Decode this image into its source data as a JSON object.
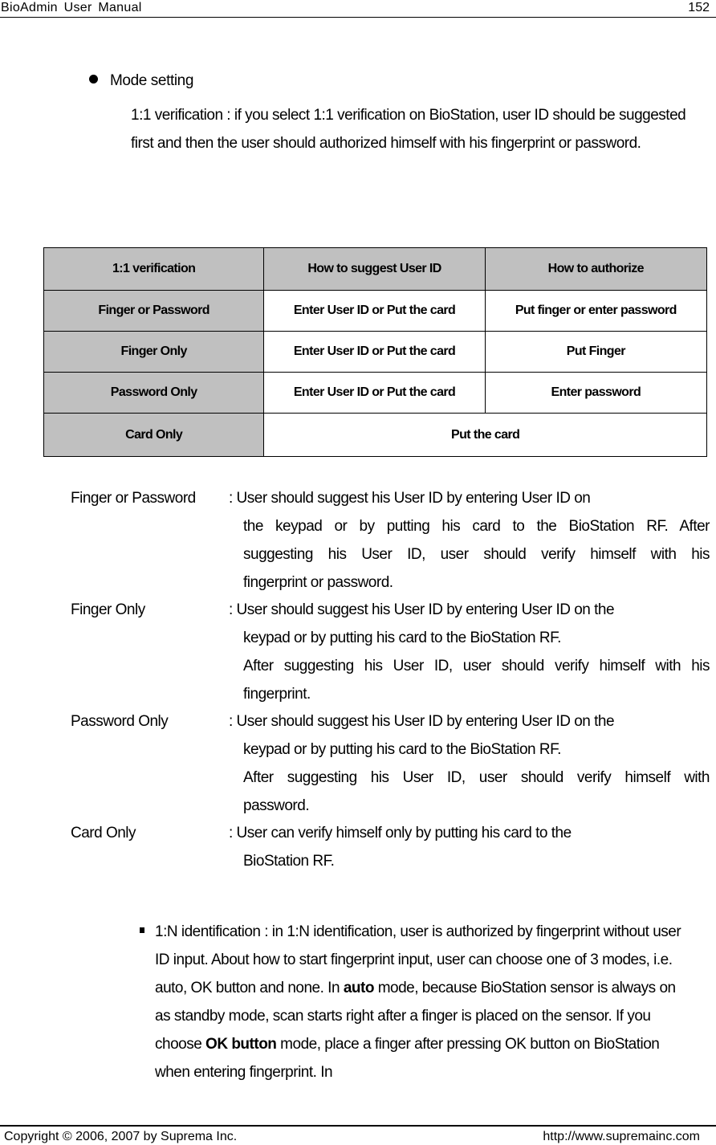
{
  "header": {
    "title": "BioAdmin  User  Manual",
    "page_number": "152"
  },
  "section": {
    "bullet_title": "Mode setting",
    "intro": "1:1 verification : if you select 1:1 verification on BioStation, user ID should be suggested first and then the user should authorized himself with his fingerprint or password."
  },
  "table": {
    "headers": [
      "1:1 verification",
      "How to suggest User ID",
      "How to authorize"
    ],
    "rows": [
      {
        "mode": "Finger or Password",
        "suggest": "Enter User ID or Put the card",
        "authorize": "Put finger or enter password"
      },
      {
        "mode": "Finger Only",
        "suggest": "Enter User ID or Put the card",
        "authorize": "Put Finger"
      },
      {
        "mode": "Password Only",
        "suggest": "Enter User ID or Put the card",
        "authorize": "Enter password"
      },
      {
        "mode": "Card Only",
        "merged": "Put the card"
      }
    ]
  },
  "definitions": [
    {
      "term": "Finger or Password",
      "first_line": ": User should suggest his User ID by entering User ID on",
      "lines": [
        "the keypad or by putting his card to the BioStation RF. After",
        "suggesting his User ID, user should verify himself with his",
        "fingerprint or password."
      ]
    },
    {
      "term": "Finger Only",
      "first_line": ": User should suggest his User ID by entering User ID on the",
      "lines": [
        "keypad or by putting his card to the BioStation RF.",
        "After suggesting his User ID, user should verify himself with his",
        "fingerprint."
      ]
    },
    {
      "term": "Password Only",
      "first_line": ": User should suggest his User ID by entering User ID on the",
      "lines": [
        "keypad or by putting his card to the BioStation RF.",
        "After suggesting his User ID, user should verify himself with",
        "password."
      ]
    },
    {
      "term": "Card Only",
      "first_line": ": User can verify himself only by putting his card to the",
      "lines": [
        "BioStation RF."
      ]
    }
  ],
  "identification": {
    "part1": "1:N identification : in 1:N identification, user is authorized by fingerprint without user ID input. About how to start fingerprint input, user can choose one of 3 modes, i.e. auto, OK button and none. In ",
    "bold1": "auto",
    "part2": " mode, because BioStation sensor is always on as standby mode, scan starts right after a finger is placed on the sensor. If you choose ",
    "bold2": "OK button",
    "part3": " mode, place a finger after pressing OK button on BioStation when entering fingerprint. In"
  },
  "footer": {
    "copyright": "Copyright © 2006, 2007 by Suprema Inc.",
    "url": "http://www.supremainc.com"
  }
}
